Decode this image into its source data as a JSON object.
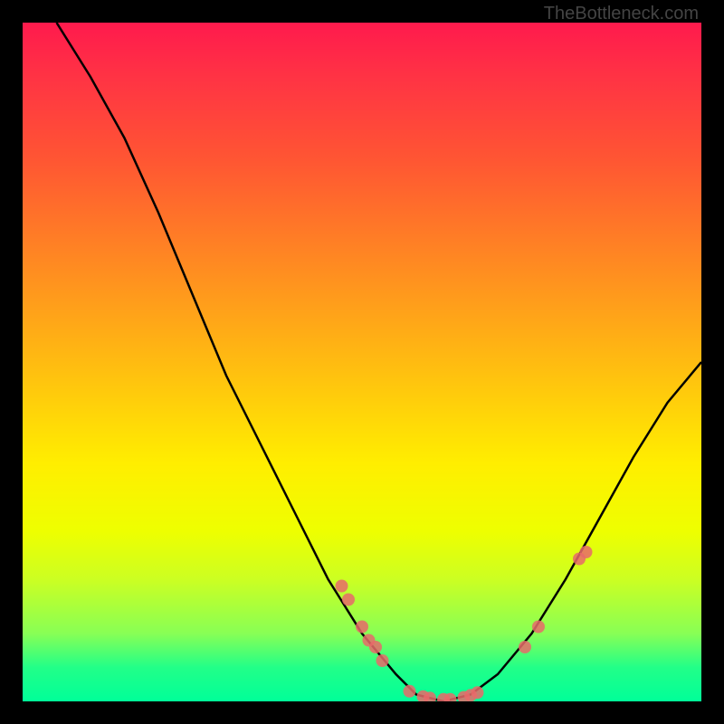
{
  "watermark": "TheBottleneck.com",
  "chart_data": {
    "type": "line",
    "title": "",
    "xlabel": "",
    "ylabel": "",
    "x_range": [
      0,
      100
    ],
    "y_range": [
      0,
      100
    ],
    "curve": [
      {
        "x": 5,
        "y": 100
      },
      {
        "x": 10,
        "y": 92
      },
      {
        "x": 15,
        "y": 83
      },
      {
        "x": 20,
        "y": 72
      },
      {
        "x": 25,
        "y": 60
      },
      {
        "x": 30,
        "y": 48
      },
      {
        "x": 35,
        "y": 38
      },
      {
        "x": 40,
        "y": 28
      },
      {
        "x": 45,
        "y": 18
      },
      {
        "x": 50,
        "y": 10
      },
      {
        "x": 55,
        "y": 4
      },
      {
        "x": 58,
        "y": 1
      },
      {
        "x": 62,
        "y": 0
      },
      {
        "x": 66,
        "y": 1
      },
      {
        "x": 70,
        "y": 4
      },
      {
        "x": 75,
        "y": 10
      },
      {
        "x": 80,
        "y": 18
      },
      {
        "x": 85,
        "y": 27
      },
      {
        "x": 90,
        "y": 36
      },
      {
        "x": 95,
        "y": 44
      },
      {
        "x": 100,
        "y": 50
      }
    ],
    "markers": [
      {
        "x": 47,
        "y": 17
      },
      {
        "x": 48,
        "y": 15
      },
      {
        "x": 50,
        "y": 11
      },
      {
        "x": 51,
        "y": 9
      },
      {
        "x": 52,
        "y": 8
      },
      {
        "x": 53,
        "y": 6
      },
      {
        "x": 57,
        "y": 1.5
      },
      {
        "x": 59,
        "y": 0.7
      },
      {
        "x": 60,
        "y": 0.5
      },
      {
        "x": 62,
        "y": 0.3
      },
      {
        "x": 63,
        "y": 0.3
      },
      {
        "x": 65,
        "y": 0.6
      },
      {
        "x": 66,
        "y": 0.9
      },
      {
        "x": 67,
        "y": 1.3
      },
      {
        "x": 74,
        "y": 8
      },
      {
        "x": 76,
        "y": 11
      },
      {
        "x": 82,
        "y": 21
      },
      {
        "x": 83,
        "y": 22
      }
    ],
    "gradient_stops": [
      {
        "pos": 0,
        "color": "#ff1a4d"
      },
      {
        "pos": 50,
        "color": "#ffee00"
      },
      {
        "pos": 100,
        "color": "#00ff99"
      }
    ]
  }
}
